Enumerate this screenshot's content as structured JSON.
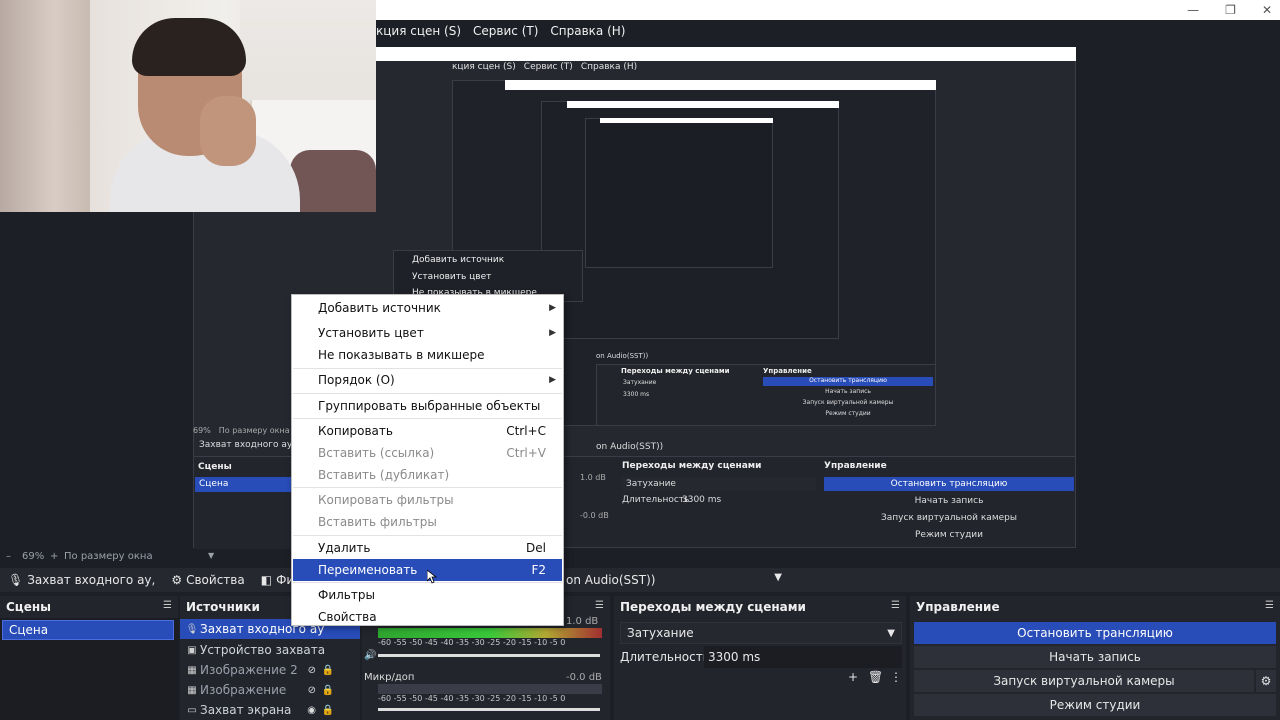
{
  "window": {
    "minimize": "—",
    "maximize": "❐",
    "close": "✕"
  },
  "menu": [
    "кция сцен (S)",
    "Сервис (T)",
    "Справка (H)"
  ],
  "preview": {
    "inner_menu": [
      "кция сцен (S)",
      "Сервис (T)",
      "Справка (H)"
    ],
    "inner_scenes_title": "Сцены",
    "inner_scene": "Сцена",
    "inner_source": "Захват входного ау",
    "inner_zoom": "69%",
    "inner_fit": "По размеру окна",
    "inner_audio": "on Audio(SST))",
    "inner_transitions_title": "Переходы между сценами",
    "inner_fade": "Затухание",
    "inner_duration_label": "Длительность",
    "inner_duration": "3300 ms",
    "inner_controls_title": "Управление",
    "inner_stop": "Остановить трансляцию",
    "inner_record": "Начать запись",
    "inner_vcam": "Запуск виртуальной камеры",
    "inner_studio": "Режим студии",
    "inner_db1": "1.0 dB",
    "inner_db2": "-0.0 dB",
    "inner_ctx": [
      "Добавить источник",
      "Установить цвет",
      "Не показывать в микшере"
    ]
  },
  "zoom": {
    "value": "69%",
    "fit": "По размеру окна"
  },
  "toolbar": {
    "source_label": "Захват входного ау,",
    "properties": "Свойства",
    "filters": "Фильтр",
    "audio_device": "on Audio(SST))"
  },
  "scenes": {
    "title": "Сцены",
    "items": [
      "Сцена"
    ]
  },
  "sources": {
    "title": "Источники",
    "items": [
      "Захват входного ау",
      "Устройство захвата",
      "Изображение 2",
      "Изображение",
      "Захват экрана"
    ]
  },
  "mixer": {
    "db1": "1.0 dB",
    "mic_label": "Микр/доп",
    "db2": "-0.0 dB",
    "scale": "-60 -55 -50 -45 -40 -35 -30 -25 -20 -15 -10 -5 0"
  },
  "transitions": {
    "title": "Переходы между сценами",
    "type": "Затухание",
    "duration_label": "Длительность",
    "duration": "3300 ms"
  },
  "controls": {
    "title": "Управление",
    "stop_stream": "Остановить трансляцию",
    "start_record": "Начать запись",
    "virtual_cam": "Запуск виртуальной камеры",
    "studio_mode": "Режим студии"
  },
  "context_menu": {
    "add_source": "Добавить источник",
    "set_color": "Установить цвет",
    "hide_in_mixer": "Не показывать в микшере",
    "order": "Порядок (O)",
    "group": "Группировать выбранные объекты",
    "copy": "Копировать",
    "copy_sc": "Ctrl+C",
    "paste_ref": "Вставить (ссылка)",
    "paste_ref_sc": "Ctrl+V",
    "paste_dup": "Вставить (дубликат)",
    "copy_filters": "Копировать фильтры",
    "paste_filters": "Вставить фильтры",
    "delete": "Удалить",
    "delete_sc": "Del",
    "rename": "Переименовать",
    "rename_sc": "F2",
    "filters": "Фильтры",
    "properties": "Свойства"
  },
  "colors": {
    "accent": "#284cb8",
    "panel": "#23252d",
    "bg": "#1d1f26"
  }
}
